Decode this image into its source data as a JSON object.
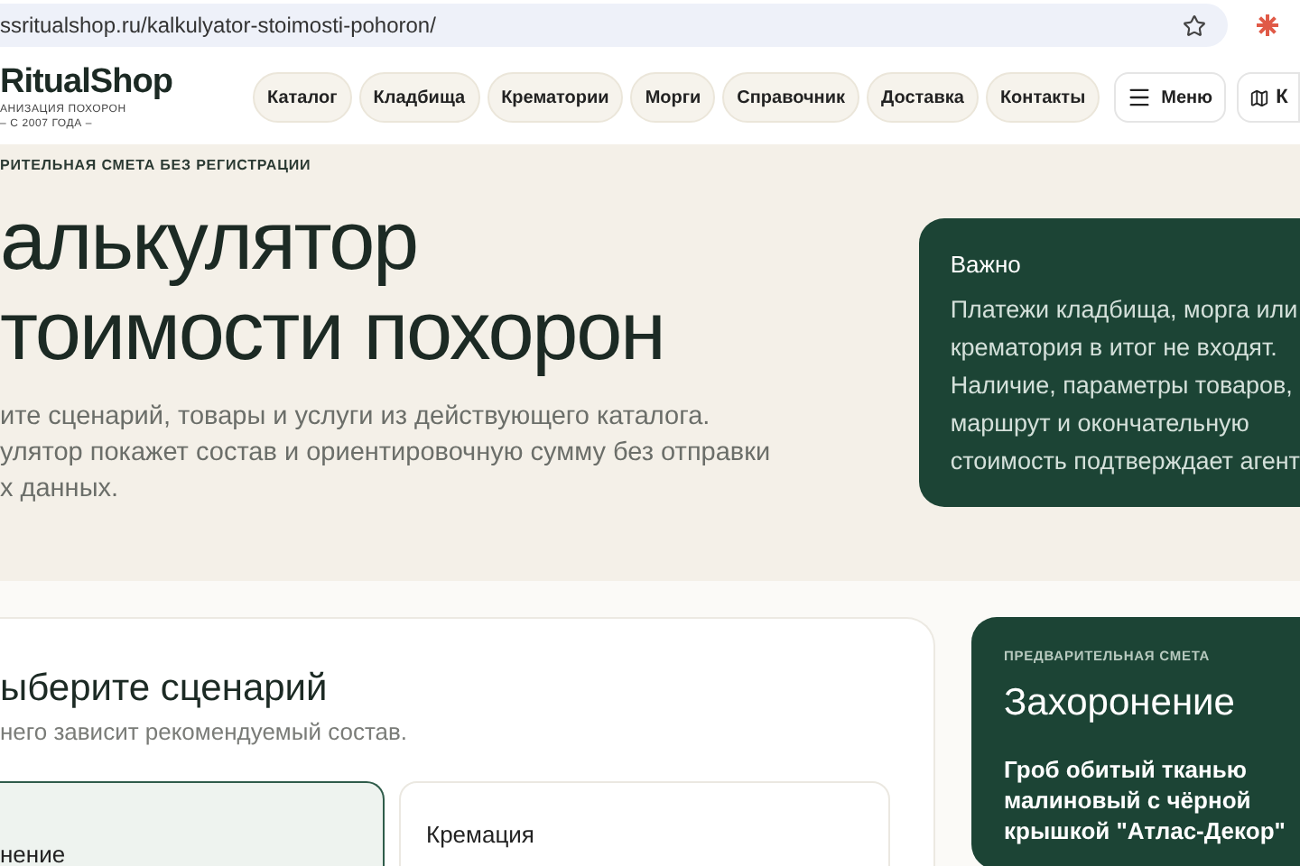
{
  "browser": {
    "url": "ssritualshop.ru/kalkulyator-stoimosti-pohoron/"
  },
  "header": {
    "logo": "RitualShop",
    "logo_tagline": "АНИЗАЦИЯ ПОХОРОН",
    "logo_since": "– С 2007 ГОДА –",
    "nav": [
      "Каталог",
      "Кладбища",
      "Крематории",
      "Морги",
      "Справочник",
      "Доставка",
      "Контакты"
    ],
    "menu_button": "Меню",
    "map_button": "К"
  },
  "hero": {
    "eyebrow": "РИТЕЛЬНАЯ СМЕТА БЕЗ РЕГИСТРАЦИИ",
    "title_lines": [
      "алькулятор",
      "тоимости похорон"
    ],
    "description_lines": [
      "ите сценарий, товары и услуги из действующего каталога.",
      "улятор покажет состав и ориентировочную сумму без отправки",
      "х данных."
    ],
    "notice": {
      "title": "Важно",
      "text_lines": [
        "Платежи кладбища, морга или",
        "крематория в итог не входят.",
        "Наличие, параметры товаров,",
        "маршрут и окончательную",
        "стоимость подтверждает агент"
      ]
    }
  },
  "scenario": {
    "title": "ыберите сценарий",
    "subtitle": "него зависит рекомендуемый состав.",
    "options": [
      {
        "label": "нение",
        "selected": true
      },
      {
        "label": "Кремация",
        "selected": false
      }
    ]
  },
  "estimate": {
    "eyebrow": "ПРЕДВАРИТЕЛЬНАЯ СМЕТА",
    "title": "Захоронение",
    "item": "Гроб обитый тканью малиновый с чёрной крышкой \"Атлас-Декор\""
  }
}
